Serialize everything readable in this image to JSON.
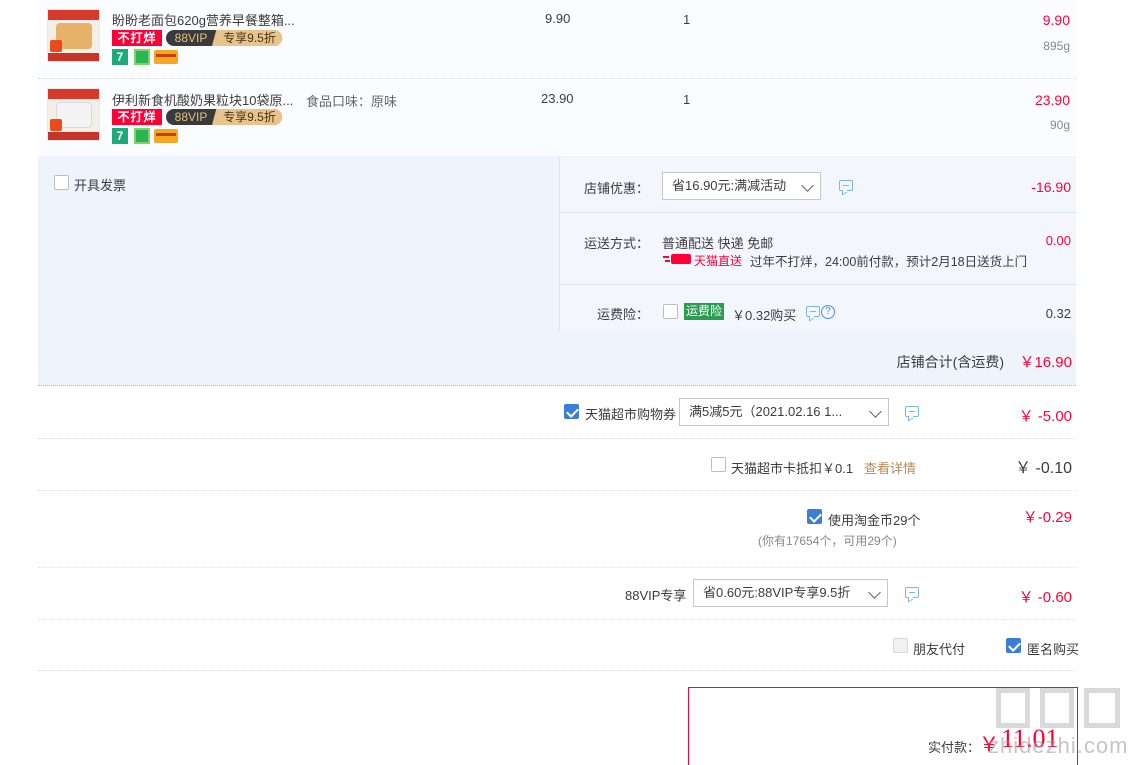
{
  "items": [
    {
      "title": "盼盼老面包620g营养早餐整箱...",
      "spec": "",
      "price": "9.90",
      "qty": "1",
      "subtotal": "9.90",
      "weight": "895g",
      "badge_nodaze": "不打烊",
      "badge_vip": "88VIP",
      "badge_discount": "专享9.5折",
      "badge_seven": "7"
    },
    {
      "title": "伊利新食机酸奶果粒块10袋原...",
      "spec": "食品口味：原味",
      "price": "23.90",
      "qty": "1",
      "subtotal": "23.90",
      "weight": "90g",
      "badge_nodaze": "不打烊",
      "badge_vip": "88VIP",
      "badge_discount": "专享9.5折",
      "badge_seven": "7"
    }
  ],
  "shop": {
    "invoice_label": "开具发票",
    "discount_label": "店铺优惠：",
    "discount_select": "省16.90元:满减活动",
    "discount_amount": "-16.90",
    "shipping_label": "运送方式：",
    "shipping_method": "普通配送 快递 免邮",
    "shipping_amount": "0.00",
    "tmall_direct": "天猫直送",
    "shipping_note": "过年不打烊，24:00前付款，预计2月18日送货上门",
    "insurance_label": "运费险：",
    "insurance_tag": "运费险",
    "insurance_price": "￥0.32购买",
    "insurance_amount": "0.32",
    "total_label": "店铺合计(含运费)",
    "total_amount": "￥16.90"
  },
  "coupon": {
    "label": "天猫超市购物券",
    "select": "满5减5元（2021.02.16 1...",
    "amount": "￥ -5.00"
  },
  "card": {
    "label": "天猫超市卡抵扣￥0.1",
    "link": "查看详情",
    "amount": "￥ -0.10"
  },
  "coins": {
    "label": "使用淘金币29个",
    "note": "(你有17654个，可用29个)",
    "amount": "￥-0.29"
  },
  "vip": {
    "label": "88VIP专享",
    "select": "省0.60元:88VIP专享9.5折",
    "amount": "￥ -0.60"
  },
  "options": {
    "friend_pay": "朋友代付",
    "anonymous": "匿名购买"
  },
  "payment": {
    "label": "实付款：",
    "currency": "￥",
    "amount": "11.01"
  },
  "watermark": {
    "site": "zhidezhi.com"
  }
}
